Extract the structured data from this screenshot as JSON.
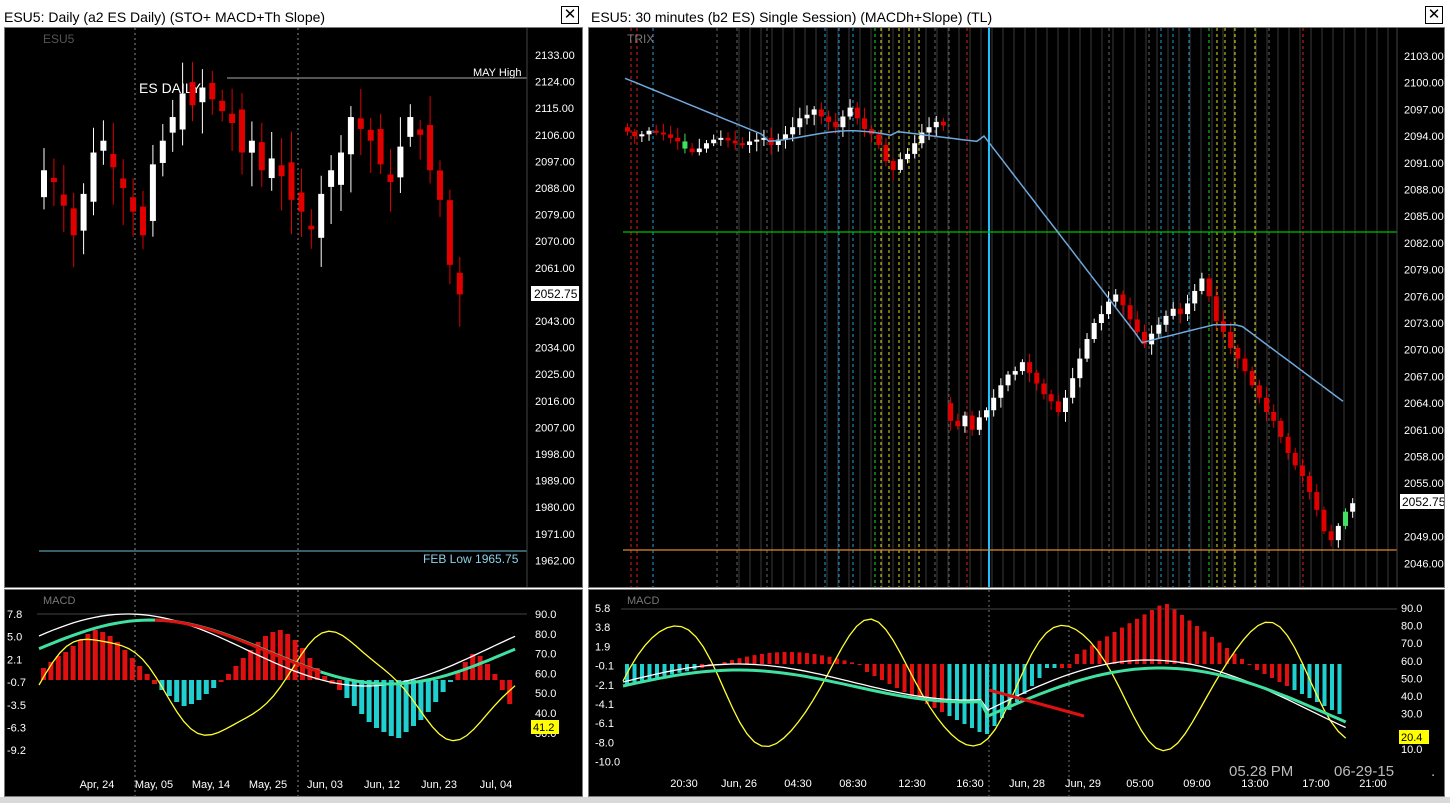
{
  "left_window": {
    "title": "ESU5: Daily (a2 ES Daily)   (STO+ MACD+Th Slope)",
    "close_label": "✕",
    "symbol_label": "ESU5",
    "chart_label": "ES DAILY",
    "may_high_label": "MAY  High",
    "feb_low_label": "FEB Low 1965.75",
    "last_price": "2052.75",
    "price_axis": [
      "2133.00",
      "2124.00",
      "2115.00",
      "2106.00",
      "2097.00",
      "2088.00",
      "2079.00",
      "2070.00",
      "2061.00",
      "2043.00",
      "2034.00",
      "2025.00",
      "2016.00",
      "2007.00",
      "1998.00",
      "1989.00",
      "1980.00",
      "1971.00",
      "1962.00"
    ],
    "macd_label": "MACD",
    "macd_left_axis": [
      "7.8",
      "5.0",
      "2.1",
      "-0.7",
      "-3.5",
      "-6.3",
      "-9.2"
    ],
    "macd_right_axis": [
      "90.0",
      "80.0",
      "70.0",
      "60.0",
      "50.0",
      "40.0",
      "30.0"
    ],
    "macd_value": "41.2",
    "date_axis": [
      "Apr, 24",
      "May, 05",
      "May, 14",
      "May, 25",
      "Jun, 03",
      "Jun, 12",
      "Jun, 23",
      "Jul, 04"
    ]
  },
  "right_window": {
    "title": "ESU5: 30 minutes (b2 ES)    Single Session) (MACDh+Slope) (TL)",
    "close_label": "✕",
    "indicator_label": "TRIX",
    "last_price": "2052.75",
    "price_axis": [
      "2103.00",
      "2100.00",
      "2097.00",
      "2094.00",
      "2091.00",
      "2088.00",
      "2085.00",
      "2082.00",
      "2079.00",
      "2076.00",
      "2073.00",
      "2070.00",
      "2067.00",
      "2064.00",
      "2061.00",
      "2058.00",
      "2055.00",
      "2049.00",
      "2046.00"
    ],
    "macd_label": "MACD",
    "macd_left_axis": [
      "5.8",
      "3.8",
      "1.9",
      "-0.1",
      "-2.1",
      "-4.1",
      "-6.1",
      "-8.0",
      "-10.0"
    ],
    "macd_right_axis": [
      "90.0",
      "80.0",
      "70.0",
      "60.0",
      "50.0",
      "40.0",
      "30.0",
      "10.0"
    ],
    "macd_value": "20.4",
    "time_axis": [
      "20:30",
      "Jun, 26",
      "04:30",
      "08:30",
      "12:30",
      "16:30",
      "Jun, 28",
      "Jun, 29",
      "05:00",
      "09:00",
      "13:00",
      "17:00",
      "21:00"
    ],
    "clock_time": "05.28 PM",
    "clock_date": "06-29-15",
    "clock_dot": "."
  },
  "colors": {
    "up_candle": "#ffffff",
    "down_candle": "#e00000",
    "ma_line": "#6fa8dc",
    "support_line": "#00c000",
    "low_line": "#e08a2a",
    "hist_pos": "#e01010",
    "hist_neg": "#20d0d0",
    "stoch": "#ffff30",
    "signal": "#40e0a0",
    "highlight": "#ffff00"
  }
}
